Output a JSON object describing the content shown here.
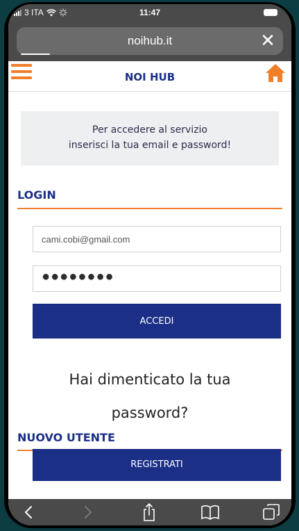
{
  "status": {
    "carrier": "3 ITA",
    "time": "11:47"
  },
  "browser": {
    "url": "noihub.it",
    "close_label": "✕"
  },
  "header": {
    "title": "NOI HUB"
  },
  "info": {
    "line1": "Per accedere al servizio",
    "line2": "inserisci la tua email e password!"
  },
  "login": {
    "title": "LOGIN",
    "email_value": "cami.cobi@gmail.com",
    "password_value": "●●●●●●●●",
    "submit_label": "ACCEDI",
    "forgot_label": "Hai dimenticato la tua password?"
  },
  "new_user": {
    "title": "NUOVO UTENTE",
    "register_label": "REGISTRATI"
  },
  "colors": {
    "accent_orange": "#f07f2a",
    "brand_blue": "#1b2f87",
    "chrome_gray": "#4a4a4a"
  },
  "icons": {
    "menu": "hamburger-menu-icon",
    "home": "home-icon",
    "back": "chevron-left-icon",
    "forward": "chevron-right-icon",
    "share": "share-icon",
    "bookmarks": "book-icon",
    "tabs": "tabs-icon"
  }
}
